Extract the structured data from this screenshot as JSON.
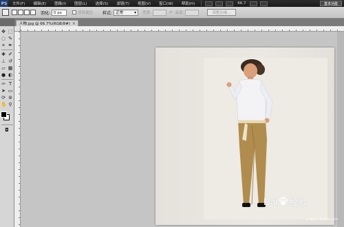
{
  "menubar": {
    "logo": "PS",
    "items": [
      "文件(F)",
      "编辑(E)",
      "图像(I)",
      "图层(L)",
      "选择(S)",
      "滤镜(T)",
      "视图(V)",
      "窗口(W)",
      "帮助(H)"
    ],
    "zoom": "66.7",
    "workspace": "基本功能"
  },
  "options": {
    "feather_label": "羽化:",
    "feather_value": "0 px",
    "antialias_label": "消除锯齿",
    "style_label": "样式:",
    "style_value": "正常",
    "width_label": "宽度:",
    "height_label": "高度:",
    "refine_button": "调整边缘..."
  },
  "document": {
    "tab_title": "人物.jpg @ 66.7%(RGB/8#)",
    "close_symbol": "×"
  },
  "watermark": {
    "brand": "Bai",
    "brand_cn": "经验",
    "url": "jingyan.baidu.com"
  },
  "colors": {
    "shirt": "#f3f3f6",
    "pants": "#b08d4e",
    "hair": "#3a2a20",
    "skin": "#d9a07a"
  }
}
